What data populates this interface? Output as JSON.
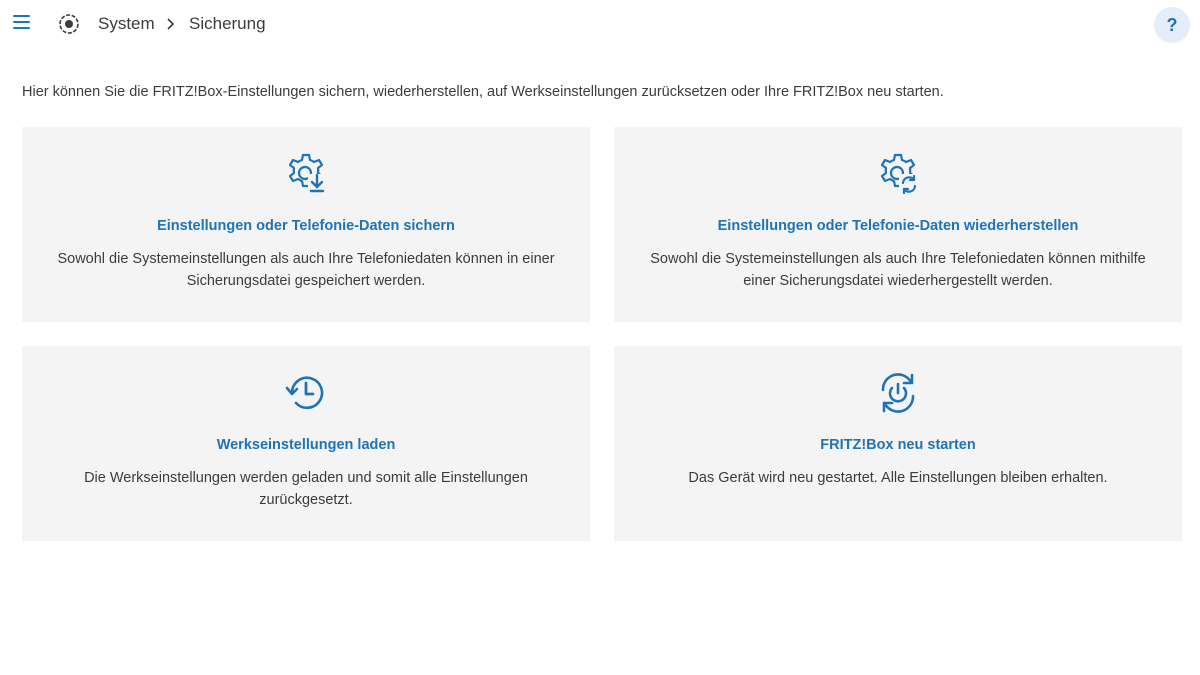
{
  "header": {
    "menu_icon": "hamburger-icon",
    "logo_icon": "fritz-logo-icon",
    "breadcrumb": {
      "parent": "System",
      "separator_icon": "chevron-right-icon",
      "current": "Sicherung"
    },
    "help_label": "?"
  },
  "intro": "Hier können Sie die FRITZ!Box-Einstellungen sichern, wiederherstellen, auf Werkseinstellungen zurücksetzen oder Ihre FRITZ!Box neu starten.",
  "cards": [
    {
      "icon": "gear-download-icon",
      "title": "Einstellungen oder Telefonie-Daten sichern",
      "description": "Sowohl die Systemeinstellungen als auch Ihre Telefoniedaten können in einer Sicherungsdatei gespeichert werden."
    },
    {
      "icon": "gear-restore-icon",
      "title": "Einstellungen oder Telefonie-Daten wiederherstellen",
      "description": "Sowohl die Systemeinstellungen als auch Ihre Telefoniedaten können mithilfe einer Sicherungsdatei wiederhergestellt werden."
    },
    {
      "icon": "history-clock-icon",
      "title": "Werkseinstellungen laden",
      "description": "Die Werkseinstellungen werden geladen und somit alle Einstellungen zurückgesetzt."
    },
    {
      "icon": "power-restart-icon",
      "title": "FRITZ!Box neu starten",
      "description": "Das Gerät wird neu gestartet. Alle Einstellungen bleiben erhalten."
    }
  ],
  "colors": {
    "accent": "#1f73b7",
    "card_background": "#f4f4f4",
    "text": "#3c3c3c",
    "help_background": "#e3eef8"
  }
}
